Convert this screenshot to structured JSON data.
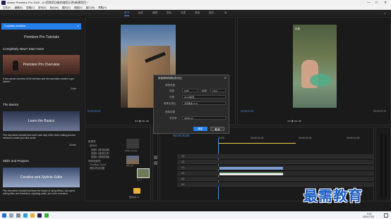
{
  "window": {
    "title": "Adobe Premiere Pro 2020 - D:\\用常用功能的使用示例\\新建项目 *"
  },
  "menu": [
    "文件(F)",
    "编辑(E)",
    "剪辑(C)",
    "序列(S)",
    "标记(M)",
    "图形(G)",
    "视图(V)",
    "窗口(W)",
    "帮助(H)"
  ],
  "workspaces": [
    "学习",
    "组件",
    "编辑",
    "颜色",
    "效果",
    "音频",
    "图形",
    "库"
  ],
  "learn": {
    "updates": "4 updates available",
    "heading": "Premiere Pro Tutorials",
    "section1": "Completely New? Start Here!",
    "card1_title": "Premiere Pro Overview",
    "card1_desc": "A two-minute overview of the interface and the essentials needed to get started.",
    "card1_time": "2 min",
    "section2": "The Basics",
    "card2_title": "Learn the Basics",
    "card2_desc": "Five interactive tutorials that cover each step of the video editing process needed to create your first movie.",
    "card2_time": "15 min",
    "section3": "Skills and Projects",
    "card3_title": "Creative and Stylistic Edits",
    "card3_desc": "Five interactive tutorials that teach the basics of using effects, clip speed, adding titles and transitions, adjusting audio, and color correction."
  },
  "source": {
    "timecode_left": "00;00;00;00",
    "timecode_right": "00;00;07;27"
  },
  "program": {
    "timecode_left": "00;00;00;00",
    "timecode_right": "00;00;07;27",
    "overlay": "抖音"
  },
  "dialog": {
    "title": "新建透明视频(或对应)",
    "video_settings": "视频设置",
    "width_label": "宽度",
    "width_value": "1080",
    "height_label": "高度",
    "height_value": "1920",
    "timebase_label": "时基",
    "timebase_value": "30.00帧/秒",
    "pixel_label": "像素长宽比",
    "pixel_value": "方形像素 (1.0)",
    "audio_settings": "音频设置",
    "sample_label": "采样率",
    "sample_value": "48000 Hz",
    "ok": "确定",
    "cancel": "取消"
  },
  "project": {
    "items": [
      "新建项",
      "序列01",
      "视频1 (黑场视频)",
      "视频2 (音频文件)",
      "视频3 (透明视频)",
      "同样视频项",
      "Creative Cloud",
      "团队项目设置"
    ],
    "thumbs": [
      "Adobe_Premie...",
      "hfas_jpg",
      "h_a_r...",
      "图像素材 03"
    ]
  },
  "timeline": {
    "timecode": "00;00;00;00",
    "ruler": [
      "00;00",
      "00;00;04;29",
      "00;00;09;29",
      "00;00;14;29"
    ],
    "tracks": [
      "V3",
      "V2",
      "V1",
      "A1",
      "A2",
      "A3"
    ]
  },
  "watermark": "最需教育",
  "taskbar": {
    "time": "9:22",
    "date": "2021/7/28"
  }
}
